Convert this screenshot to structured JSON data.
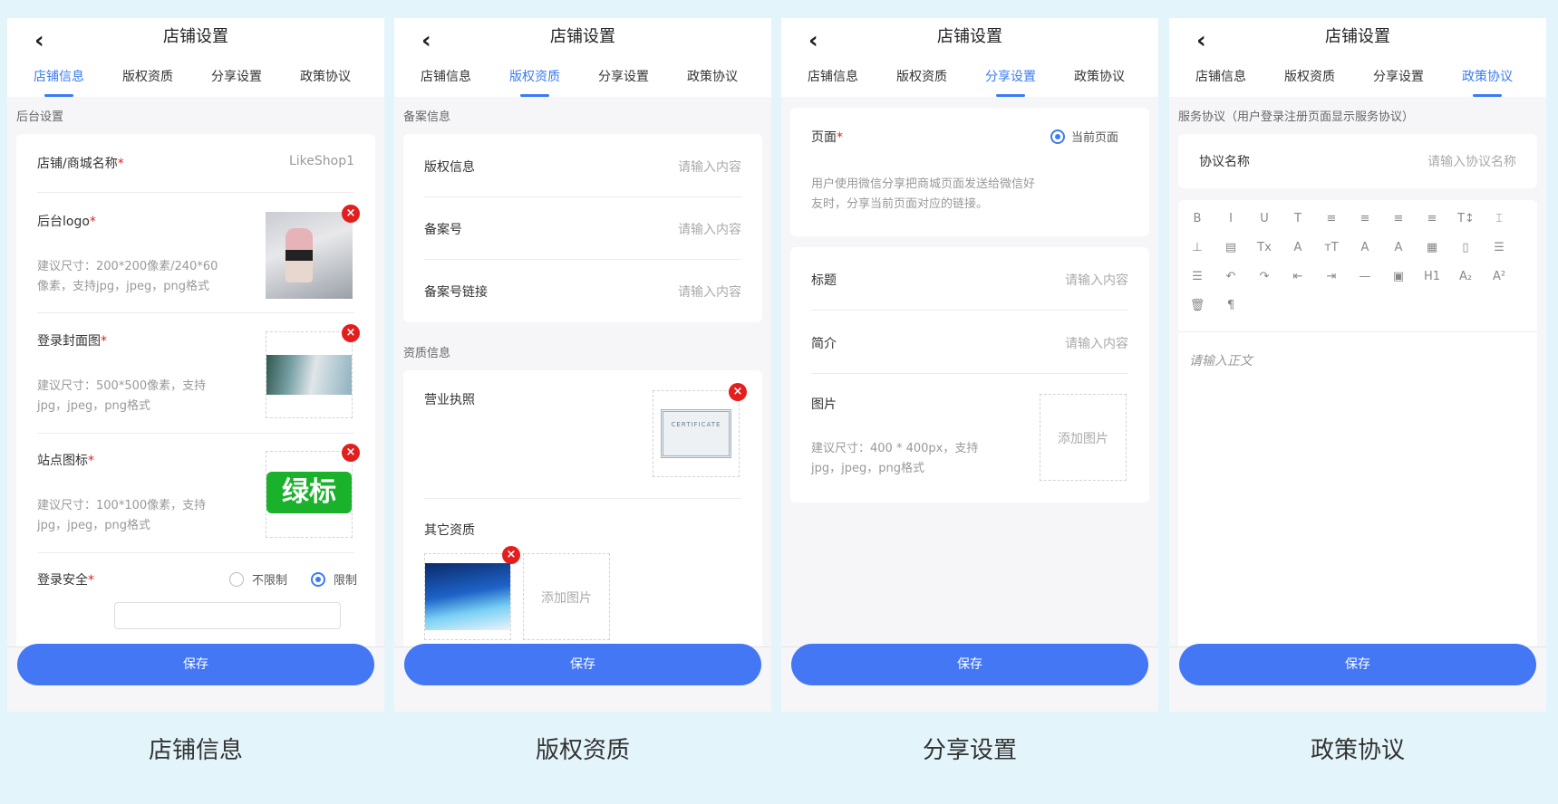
{
  "header": {
    "back_icon": "chevron-left-icon",
    "title": "店铺设置"
  },
  "tabs": [
    "店铺信息",
    "版权资质",
    "分享设置",
    "政策协议"
  ],
  "save_label": "保存",
  "captions": [
    "店铺信息",
    "版权资质",
    "分享设置",
    "政策协议"
  ],
  "colors": {
    "accent": "#3a7bf6",
    "button": "#4477f4",
    "background": "#e3f4fb",
    "delete": "#e41d1d",
    "required": "#e02020"
  },
  "delete_mark": "×",
  "required_mark": "*",
  "shop_info": {
    "section": "后台设置",
    "name_label": "店铺/商城名称",
    "name_value": "LikeShop1",
    "logo_label": "后台logo",
    "logo_hint_1": "建议尺寸：200*200像素/240*60",
    "logo_hint_2": "像素，支持jpg，jpeg，png格式",
    "cover_label": "登录封面图",
    "cover_hint_1": "建议尺寸：500*500像素，支持",
    "cover_hint_2": "jpg，jpeg，png格式",
    "icon_label": "站点图标",
    "icon_image_text": "绿标",
    "icon_hint_1": "建议尺寸：100*100像素，支持",
    "icon_hint_2": "jpg，jpeg，png格式",
    "security_label": "登录安全",
    "security_options": [
      "不限制",
      "限制"
    ],
    "security_selected": "限制"
  },
  "copyright": {
    "section_filing": "备案信息",
    "rows": [
      {
        "label": "版权信息",
        "placeholder": "请输入内容"
      },
      {
        "label": "备案号",
        "placeholder": "请输入内容"
      },
      {
        "label": "备案号链接",
        "placeholder": "请输入内容"
      }
    ],
    "section_qualification": "资质信息",
    "license_label": "营业执照",
    "certificate_text": "CERTIFICATE",
    "other_label": "其它资质",
    "add_image": "添加图片"
  },
  "share": {
    "page_label": "页面",
    "page_option": "当前页面",
    "page_desc_1": "用户使用微信分享把商城页面发送给微信好",
    "page_desc_2": "友时，分享当前页面对应的链接。",
    "title_label": "标题",
    "title_placeholder": "请输入内容",
    "intro_label": "简介",
    "intro_placeholder": "请输入内容",
    "image_label": "图片",
    "image_hint_1": "建议尺寸：400 * 400px，支持",
    "image_hint_2": "jpg，jpeg，png格式",
    "add_image": "添加图片"
  },
  "policy": {
    "section": "服务协议（用户登录注册页面显示服务协议）",
    "name_label": "协议名称",
    "name_placeholder": "请输入协议名称",
    "toolbar_row1": [
      "B",
      "I",
      "U",
      "T",
      "≡",
      "≡",
      "≡",
      "≡",
      "T↕",
      "⌶"
    ],
    "toolbar_row2": [
      "⊥",
      "▤",
      "Tx",
      "A",
      "тT",
      "A",
      "A",
      "▦",
      "▯",
      "☰"
    ],
    "toolbar_row3": [
      "☰",
      "↶",
      "↷",
      "⇤",
      "⇥",
      "—",
      "▣",
      "H1",
      "A₂",
      "A²"
    ],
    "toolbar_row4": [
      "🗑",
      "¶"
    ],
    "body_placeholder": "请输入正文"
  }
}
